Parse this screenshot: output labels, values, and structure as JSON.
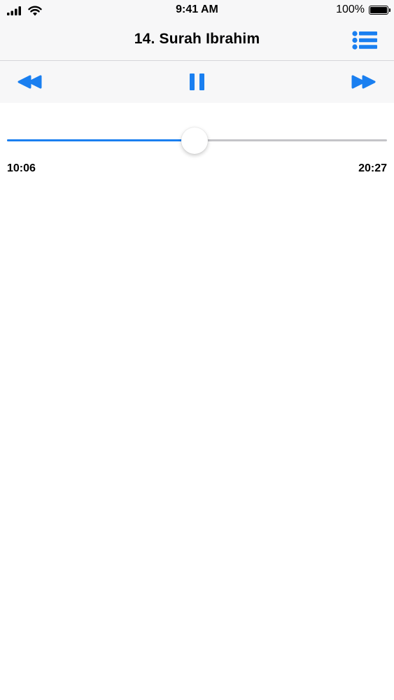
{
  "status_bar": {
    "time": "9:41 AM",
    "battery_percent": "100%",
    "battery_level": 1.0,
    "icons": [
      "cellular-signal-icon",
      "wifi-icon",
      "battery-icon"
    ]
  },
  "nav": {
    "title": "14. Surah Ibrahim",
    "right_icon": "list-icon"
  },
  "controls": {
    "accent_color": "#1a7ff0",
    "buttons": [
      "rewind-icon",
      "pause-icon",
      "fast-forward-icon"
    ]
  },
  "player": {
    "elapsed": "10:06",
    "duration": "20:27",
    "progress": 0.494
  }
}
